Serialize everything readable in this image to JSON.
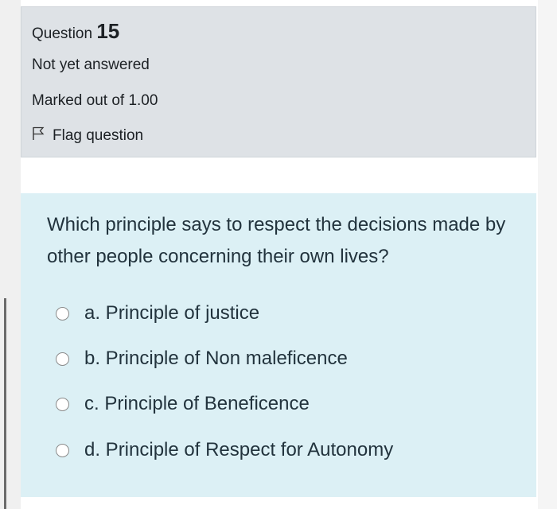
{
  "question": {
    "label": "Question",
    "number": "15",
    "state": "Not yet answered",
    "grade": "Marked out of 1.00",
    "flag_label": "Flag question",
    "flag_icon": "flag-icon"
  },
  "formulation": {
    "text": "Which principle says to respect the decisions made by other people concerning their own lives?",
    "answers": [
      {
        "label": "a. Principle of justice",
        "selected": false
      },
      {
        "label": "b. Principle of Non maleficence",
        "selected": false
      },
      {
        "label": "c. Principle of Beneficence",
        "selected": false
      },
      {
        "label": "d. Principle of Respect for Autonomy",
        "selected": false
      }
    ]
  },
  "colors": {
    "info_background": "#dee2e6",
    "formulation_background": "#dcf0f5",
    "text": "#1d2125"
  }
}
